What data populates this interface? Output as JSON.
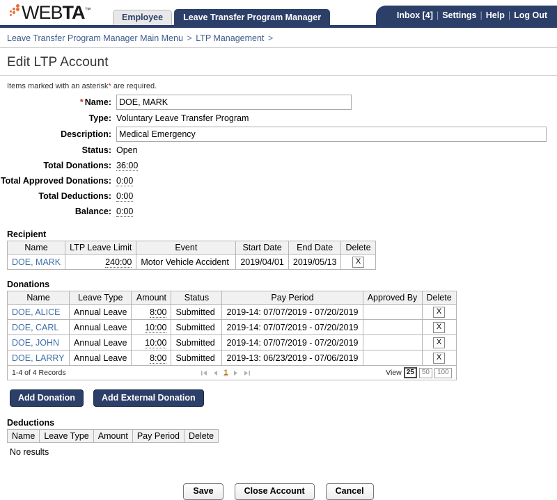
{
  "brand": {
    "logo_text_light": "WEB",
    "logo_text_bold": "TA",
    "logo_tm": "™",
    "accent_orange": "#e8703a",
    "navy": "#2c3f69"
  },
  "header": {
    "tabs": [
      {
        "label": "Employee",
        "active": false
      },
      {
        "label": "Leave Transfer Program Manager",
        "active": true
      }
    ],
    "utilnav": [
      {
        "label": "Inbox [4]"
      },
      {
        "label": "Settings"
      },
      {
        "label": "Help"
      },
      {
        "label": "Log Out"
      }
    ],
    "separator": "|"
  },
  "breadcrumb": {
    "items": [
      {
        "label": "Leave Transfer Program Manager Main Menu"
      },
      {
        "label": "LTP Management"
      }
    ],
    "separator": ">"
  },
  "page": {
    "title": "Edit LTP Account",
    "required_note_pre": "Items marked with an asterisk",
    "required_note_ast": "*",
    "required_note_post": " are required."
  },
  "form": {
    "name": {
      "label": "Name:",
      "value": "DOE, MARK",
      "required_star": "*"
    },
    "type": {
      "label": "Type:",
      "value": "Voluntary Leave Transfer Program"
    },
    "description": {
      "label": "Description:",
      "value": "Medical Emergency"
    },
    "status": {
      "label": "Status:",
      "value": "Open"
    },
    "total_donations": {
      "label": "Total Donations:",
      "value": "36:00"
    },
    "total_approved_donations": {
      "label": "Total Approved Donations:",
      "value": "0:00"
    },
    "total_deductions": {
      "label": "Total Deductions:",
      "value": "0:00"
    },
    "balance": {
      "label": "Balance:",
      "value": "0:00"
    }
  },
  "recipient": {
    "title": "Recipient",
    "columns": [
      "Name",
      "LTP Leave Limit",
      "Event",
      "Start Date",
      "End Date",
      "Delete"
    ],
    "rows": [
      {
        "name": "DOE, MARK",
        "ltp_leave_limit": "240:00",
        "event": "Motor Vehicle Accident",
        "start_date": "2019/04/01",
        "end_date": "2019/05/13",
        "delete": "X"
      }
    ]
  },
  "donations": {
    "title": "Donations",
    "columns": [
      "Name",
      "Leave Type",
      "Amount",
      "Status",
      "Pay Period",
      "Approved By",
      "Delete"
    ],
    "rows": [
      {
        "name": "DOE, ALICE",
        "leave_type": "Annual Leave",
        "amount": "8:00",
        "status": "Submitted",
        "pay_period": "2019-14: 07/07/2019 - 07/20/2019",
        "approved_by": "",
        "delete": "X"
      },
      {
        "name": "DOE, CARL",
        "leave_type": "Annual Leave",
        "amount": "10:00",
        "status": "Submitted",
        "pay_period": "2019-14: 07/07/2019 - 07/20/2019",
        "approved_by": "",
        "delete": "X"
      },
      {
        "name": "DOE, JOHN",
        "leave_type": "Annual Leave",
        "amount": "10:00",
        "status": "Submitted",
        "pay_period": "2019-14: 07/07/2019 - 07/20/2019",
        "approved_by": "",
        "delete": "X"
      },
      {
        "name": "DOE, LARRY",
        "leave_type": "Annual Leave",
        "amount": "8:00",
        "status": "Submitted",
        "pay_period": "2019-13: 06/23/2019 - 07/06/2019",
        "approved_by": "",
        "delete": "X"
      }
    ],
    "footer": {
      "records": "1-4 of 4 Records",
      "current_page": "1",
      "view_label": "View",
      "page_sizes": [
        {
          "label": "25",
          "selected": true
        },
        {
          "label": "50",
          "selected": false
        },
        {
          "label": "100",
          "selected": false
        }
      ]
    }
  },
  "donation_actions": {
    "add_donation": "Add Donation",
    "add_external_donation": "Add External Donation"
  },
  "deductions": {
    "title": "Deductions",
    "columns": [
      "Name",
      "Leave Type",
      "Amount",
      "Pay Period",
      "Delete"
    ],
    "empty_text": "No results"
  },
  "footer_actions": {
    "save": "Save",
    "close_account": "Close Account",
    "cancel": "Cancel"
  }
}
